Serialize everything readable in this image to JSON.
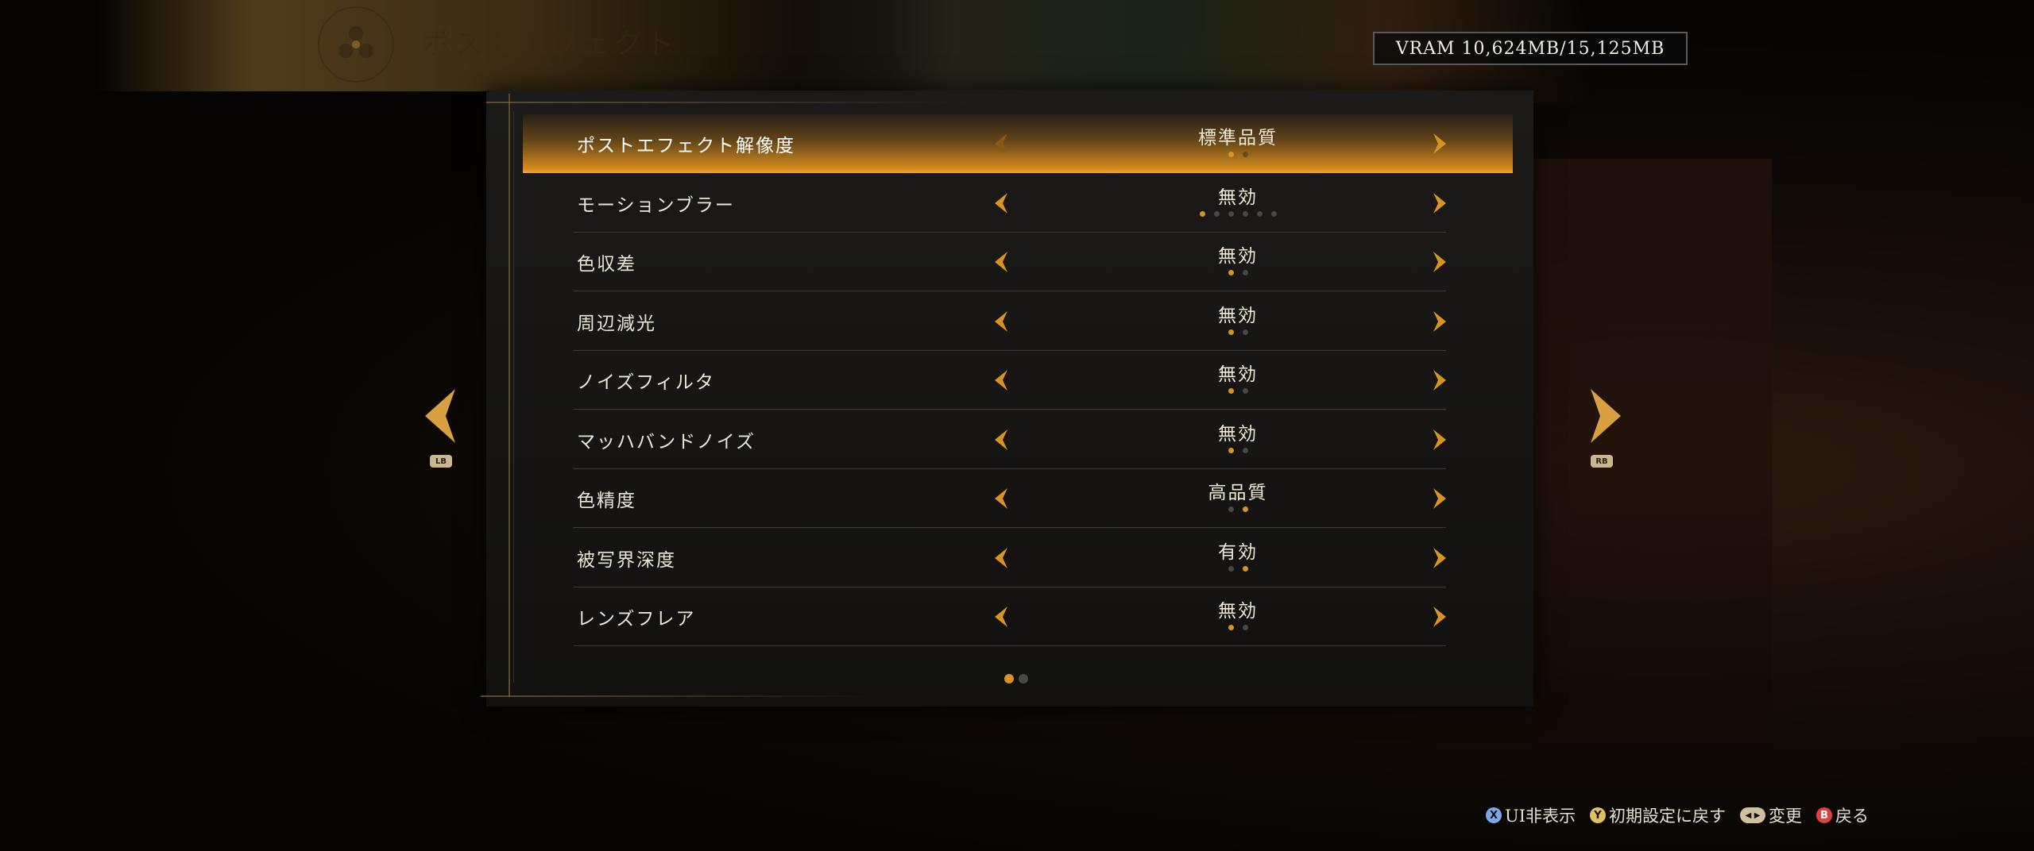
{
  "header": {
    "title": "ポストエフェクト",
    "vram": "VRAM 10,624MB/15,125MB"
  },
  "nav": {
    "prev_button_tag": "LB",
    "next_button_tag": "RB"
  },
  "settings": [
    {
      "label": "ポストエフェクト解像度",
      "value": "標準品質",
      "options": 2,
      "selected_index": 0,
      "selected": true
    },
    {
      "label": "モーションブラー",
      "value": "無効",
      "options": 6,
      "selected_index": 0
    },
    {
      "label": "色収差",
      "value": "無効",
      "options": 2,
      "selected_index": 0
    },
    {
      "label": "周辺減光",
      "value": "無効",
      "options": 2,
      "selected_index": 0
    },
    {
      "label": "ノイズフィルタ",
      "value": "無効",
      "options": 2,
      "selected_index": 0
    },
    {
      "label": "マッハバンドノイズ",
      "value": "無効",
      "options": 2,
      "selected_index": 0
    },
    {
      "label": "色精度",
      "value": "高品質",
      "options": 2,
      "selected_index": 1
    },
    {
      "label": "被写界深度",
      "value": "有効",
      "options": 2,
      "selected_index": 1
    },
    {
      "label": "レンズフレア",
      "value": "無効",
      "options": 2,
      "selected_index": 0
    }
  ],
  "pager": {
    "pages": 2,
    "current": 1
  },
  "footer": {
    "hide_ui": "UI非表示",
    "reset_defaults": "初期設定に戻す",
    "change": "変更",
    "back": "戻る",
    "button_x": "X",
    "button_y": "Y",
    "button_b": "B",
    "button_dpad": "◀ ▶"
  },
  "colors": {
    "accent": "#d99320",
    "selected_row": "#e8a030",
    "panel": "#161513"
  }
}
